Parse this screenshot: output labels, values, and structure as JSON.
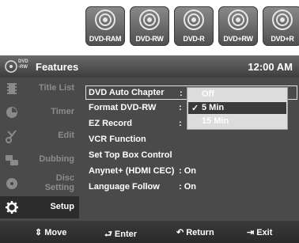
{
  "discs": [
    {
      "label": "DVD-RAM",
      "icon": "disc-icon"
    },
    {
      "label": "DVD-RW",
      "icon": "disc-icon"
    },
    {
      "label": "DVD-R",
      "icon": "disc-icon"
    },
    {
      "label": "DVD+RW",
      "icon": "disc-icon"
    },
    {
      "label": "DVD+R",
      "icon": "disc-icon"
    }
  ],
  "header": {
    "badge_top": "DVD",
    "badge_bottom": "-RW",
    "title": "Features",
    "time": "12:00 AM"
  },
  "sidebar": {
    "items": [
      {
        "label": "Title List",
        "icon": "title-list-icon"
      },
      {
        "label": "Timer",
        "icon": "timer-icon"
      },
      {
        "label": "Edit",
        "icon": "scissors-icon"
      },
      {
        "label": "Dubbing",
        "icon": "dubbing-icon"
      },
      {
        "label1": "Disc",
        "label2": "Setting",
        "icon": "disc-setting-icon"
      },
      {
        "label": "Setup",
        "icon": "gear-icon"
      }
    ],
    "active_index": 5
  },
  "menu": {
    "rows": [
      {
        "label": "DVD Auto Chapter",
        "value": ":"
      },
      {
        "label": "Format DVD-RW",
        "value": ":"
      },
      {
        "label": "EZ Record",
        "value": ":"
      },
      {
        "label": "VCR Function",
        "value": ""
      },
      {
        "label": "Set Top Box Control",
        "value": ""
      },
      {
        "label": "Anynet+ (HDMI CEC)",
        "value": ": On"
      },
      {
        "label": "Language Follow",
        "value": ": On"
      }
    ],
    "selected_index": 0
  },
  "dropdown": {
    "options": [
      "Off",
      "5 Min",
      "15 Min"
    ],
    "highlighted_index": 1,
    "checked_index": 1,
    "check_mark": "✓"
  },
  "footer": {
    "move": "Move",
    "move_icon": "⇕",
    "enter": "Enter",
    "enter_icon": "⮐",
    "return": "Return",
    "return_icon": "↶",
    "exit": "Exit",
    "exit_icon": "⇥"
  }
}
